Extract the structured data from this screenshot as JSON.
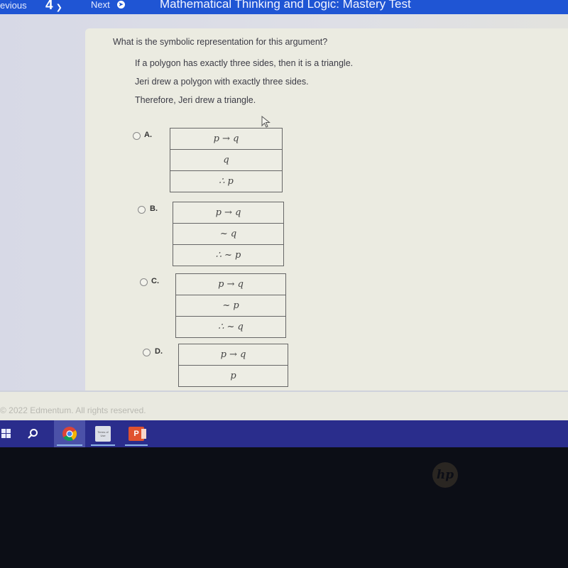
{
  "topbar": {
    "previous_label": "evious",
    "question_number": "4",
    "next_label": "Next",
    "test_title": "Mathematical Thinking and Logic: Mastery Test"
  },
  "question": {
    "prompt": "What is the symbolic representation for this argument?",
    "premises": [
      "If a polygon has exactly three sides, then it is a triangle.",
      "Jeri drew a polygon with exactly three sides.",
      "Therefore, Jeri drew a triangle."
    ]
  },
  "options": [
    {
      "letter": "A.",
      "rows": [
        "p → q",
        "q",
        "∴ p"
      ],
      "selected": false
    },
    {
      "letter": "B.",
      "rows": [
        "p → q",
        "~ q",
        "∴ ~ p"
      ],
      "selected": false
    },
    {
      "letter": "C.",
      "rows": [
        "p → q",
        "~ p",
        "∴ ~ q"
      ],
      "selected": false
    },
    {
      "letter": "D.",
      "rows": [
        "p → q",
        "p"
      ],
      "selected": false
    }
  ],
  "footer": {
    "copyright": "© 2022 Edmentum. All rights reserved."
  },
  "taskbar": {
    "items": [
      {
        "name": "start",
        "icon": "windows-icon"
      },
      {
        "name": "search",
        "icon": "search-icon"
      },
      {
        "name": "chrome",
        "icon": "chrome-icon",
        "active": true
      },
      {
        "name": "terms-of-use",
        "icon": "terms-of-use-icon",
        "label": "Terms of Use"
      },
      {
        "name": "powerpoint",
        "icon": "powerpoint-icon",
        "label": "P"
      }
    ]
  },
  "device": {
    "brand_logo": "hp"
  },
  "colors": {
    "topbar": "#1f55d4",
    "taskbar": "#2a2d8c",
    "card": "#ebebe1"
  }
}
